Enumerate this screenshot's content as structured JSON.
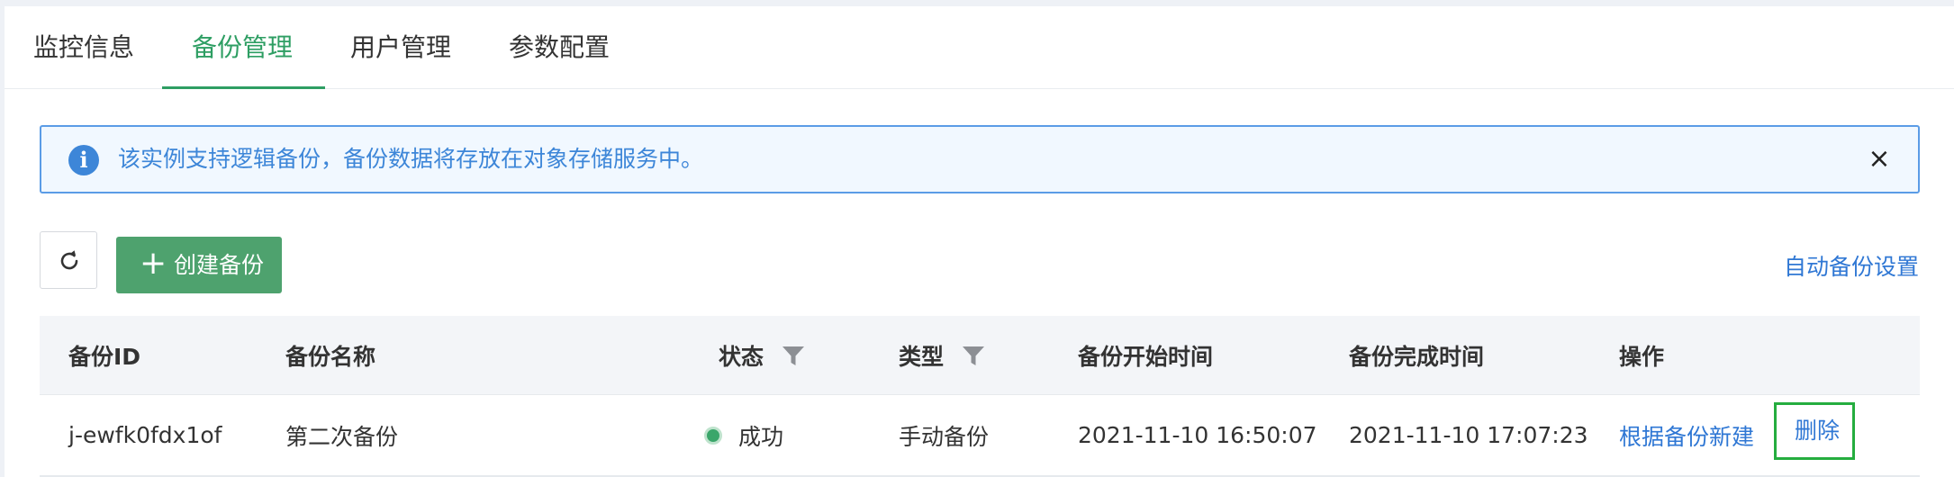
{
  "tabs": [
    {
      "label": "监控信息"
    },
    {
      "label": "备份管理"
    },
    {
      "label": "用户管理"
    },
    {
      "label": "参数配置"
    }
  ],
  "active_tab": "备份管理",
  "alert": {
    "icon": "info-icon",
    "text": "该实例支持逻辑备份，备份数据将存放在对象存储服务中。",
    "close": "×"
  },
  "toolbar": {
    "refresh_icon": "refresh-icon",
    "create_label": "创建备份",
    "create_plus": "+",
    "auto_backup_link": "自动备份设置"
  },
  "table": {
    "columns": [
      "备份ID",
      "备份名称",
      "状态",
      "类型",
      "备份开始时间",
      "备份完成时间",
      "操作"
    ],
    "rows": [
      {
        "id": "j-ewfk0fdx1of",
        "name": "第二次备份",
        "status": "成功",
        "type": "手动备份",
        "start_time": "2021-11-10 16:50:07",
        "end_time": "2021-11-10 17:07:23",
        "actions": [
          "根据备份新建",
          "删除"
        ]
      }
    ]
  },
  "colors": {
    "accent_green": "#2e9e63",
    "button_green": "#4ea26e",
    "link_blue": "#2f77d4",
    "alert_border": "#5b9ce6",
    "alert_bg": "#f1f8ff",
    "status_success": "#3aa66a",
    "highlight_box": "#25ad3f"
  }
}
